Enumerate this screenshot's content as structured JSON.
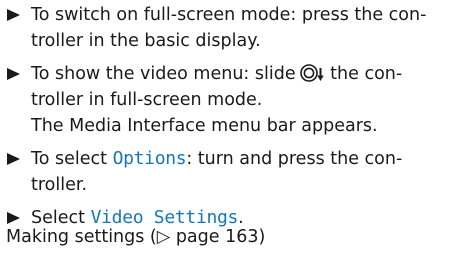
{
  "steps": [
    {
      "lines": [
        "To switch on full-screen mode: press the con-",
        "troller in the basic display."
      ]
    },
    {
      "line1_before": "To show the video menu: slide",
      "line1_after": "the con-",
      "line2": "troller in full-screen mode.",
      "line3": "The Media Interface menu bar appears."
    },
    {
      "line1_before": "To select",
      "keyword": "Options",
      "line1_after": ": turn and press the con-",
      "line2": "troller."
    },
    {
      "before": "Select",
      "keyword": "Video Settings",
      "after": "."
    }
  ],
  "footer": {
    "prefix": "Making settings (",
    "arrow": "▷",
    "page_ref": "page 163)"
  },
  "colors": {
    "text": "#1a1a1a",
    "keyword": "#1677b8"
  },
  "icons": {
    "bullet": "triangle-right-icon",
    "controller": "controller-slide-down-icon"
  }
}
